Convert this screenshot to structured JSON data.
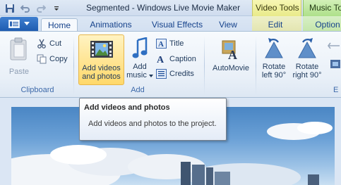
{
  "window": {
    "title": "Segmented - Windows Live Movie Maker",
    "context_tabs": {
      "video_tools": "Video Tools",
      "music_tools": "Music To"
    }
  },
  "tabs": [
    {
      "label": "Home"
    },
    {
      "label": "Animations"
    },
    {
      "label": "Visual Effects"
    },
    {
      "label": "View"
    },
    {
      "label": "Edit"
    },
    {
      "label": "Option"
    }
  ],
  "ribbon": {
    "clipboard": {
      "label": "Clipboard",
      "paste": "Paste",
      "cut": "Cut",
      "copy": "Copy"
    },
    "add": {
      "label": "Add",
      "add_videos_line1": "Add videos",
      "add_videos_line2": "and photos",
      "add_music_line1": "Add",
      "add_music_line2": "music",
      "title": "Title",
      "caption": "Caption",
      "credits": "Credits"
    },
    "automovie": "AutoMovie",
    "rotate_left_line1": "Rotate",
    "rotate_left_line2": "left 90°",
    "rotate_right_line1": "Rotate",
    "rotate_right_line2": "right 90°",
    "edit_group_partial": "E"
  },
  "tooltip": {
    "title": "Add videos and photos",
    "body": "Add videos and photos to the project."
  },
  "colors": {
    "ribbon_bg": "#e9f0f8",
    "accent_blue": "#1f5cb0",
    "video_tools": "#e9ea8a",
    "music_tools": "#aee08a",
    "hover": "#ffd86a"
  }
}
